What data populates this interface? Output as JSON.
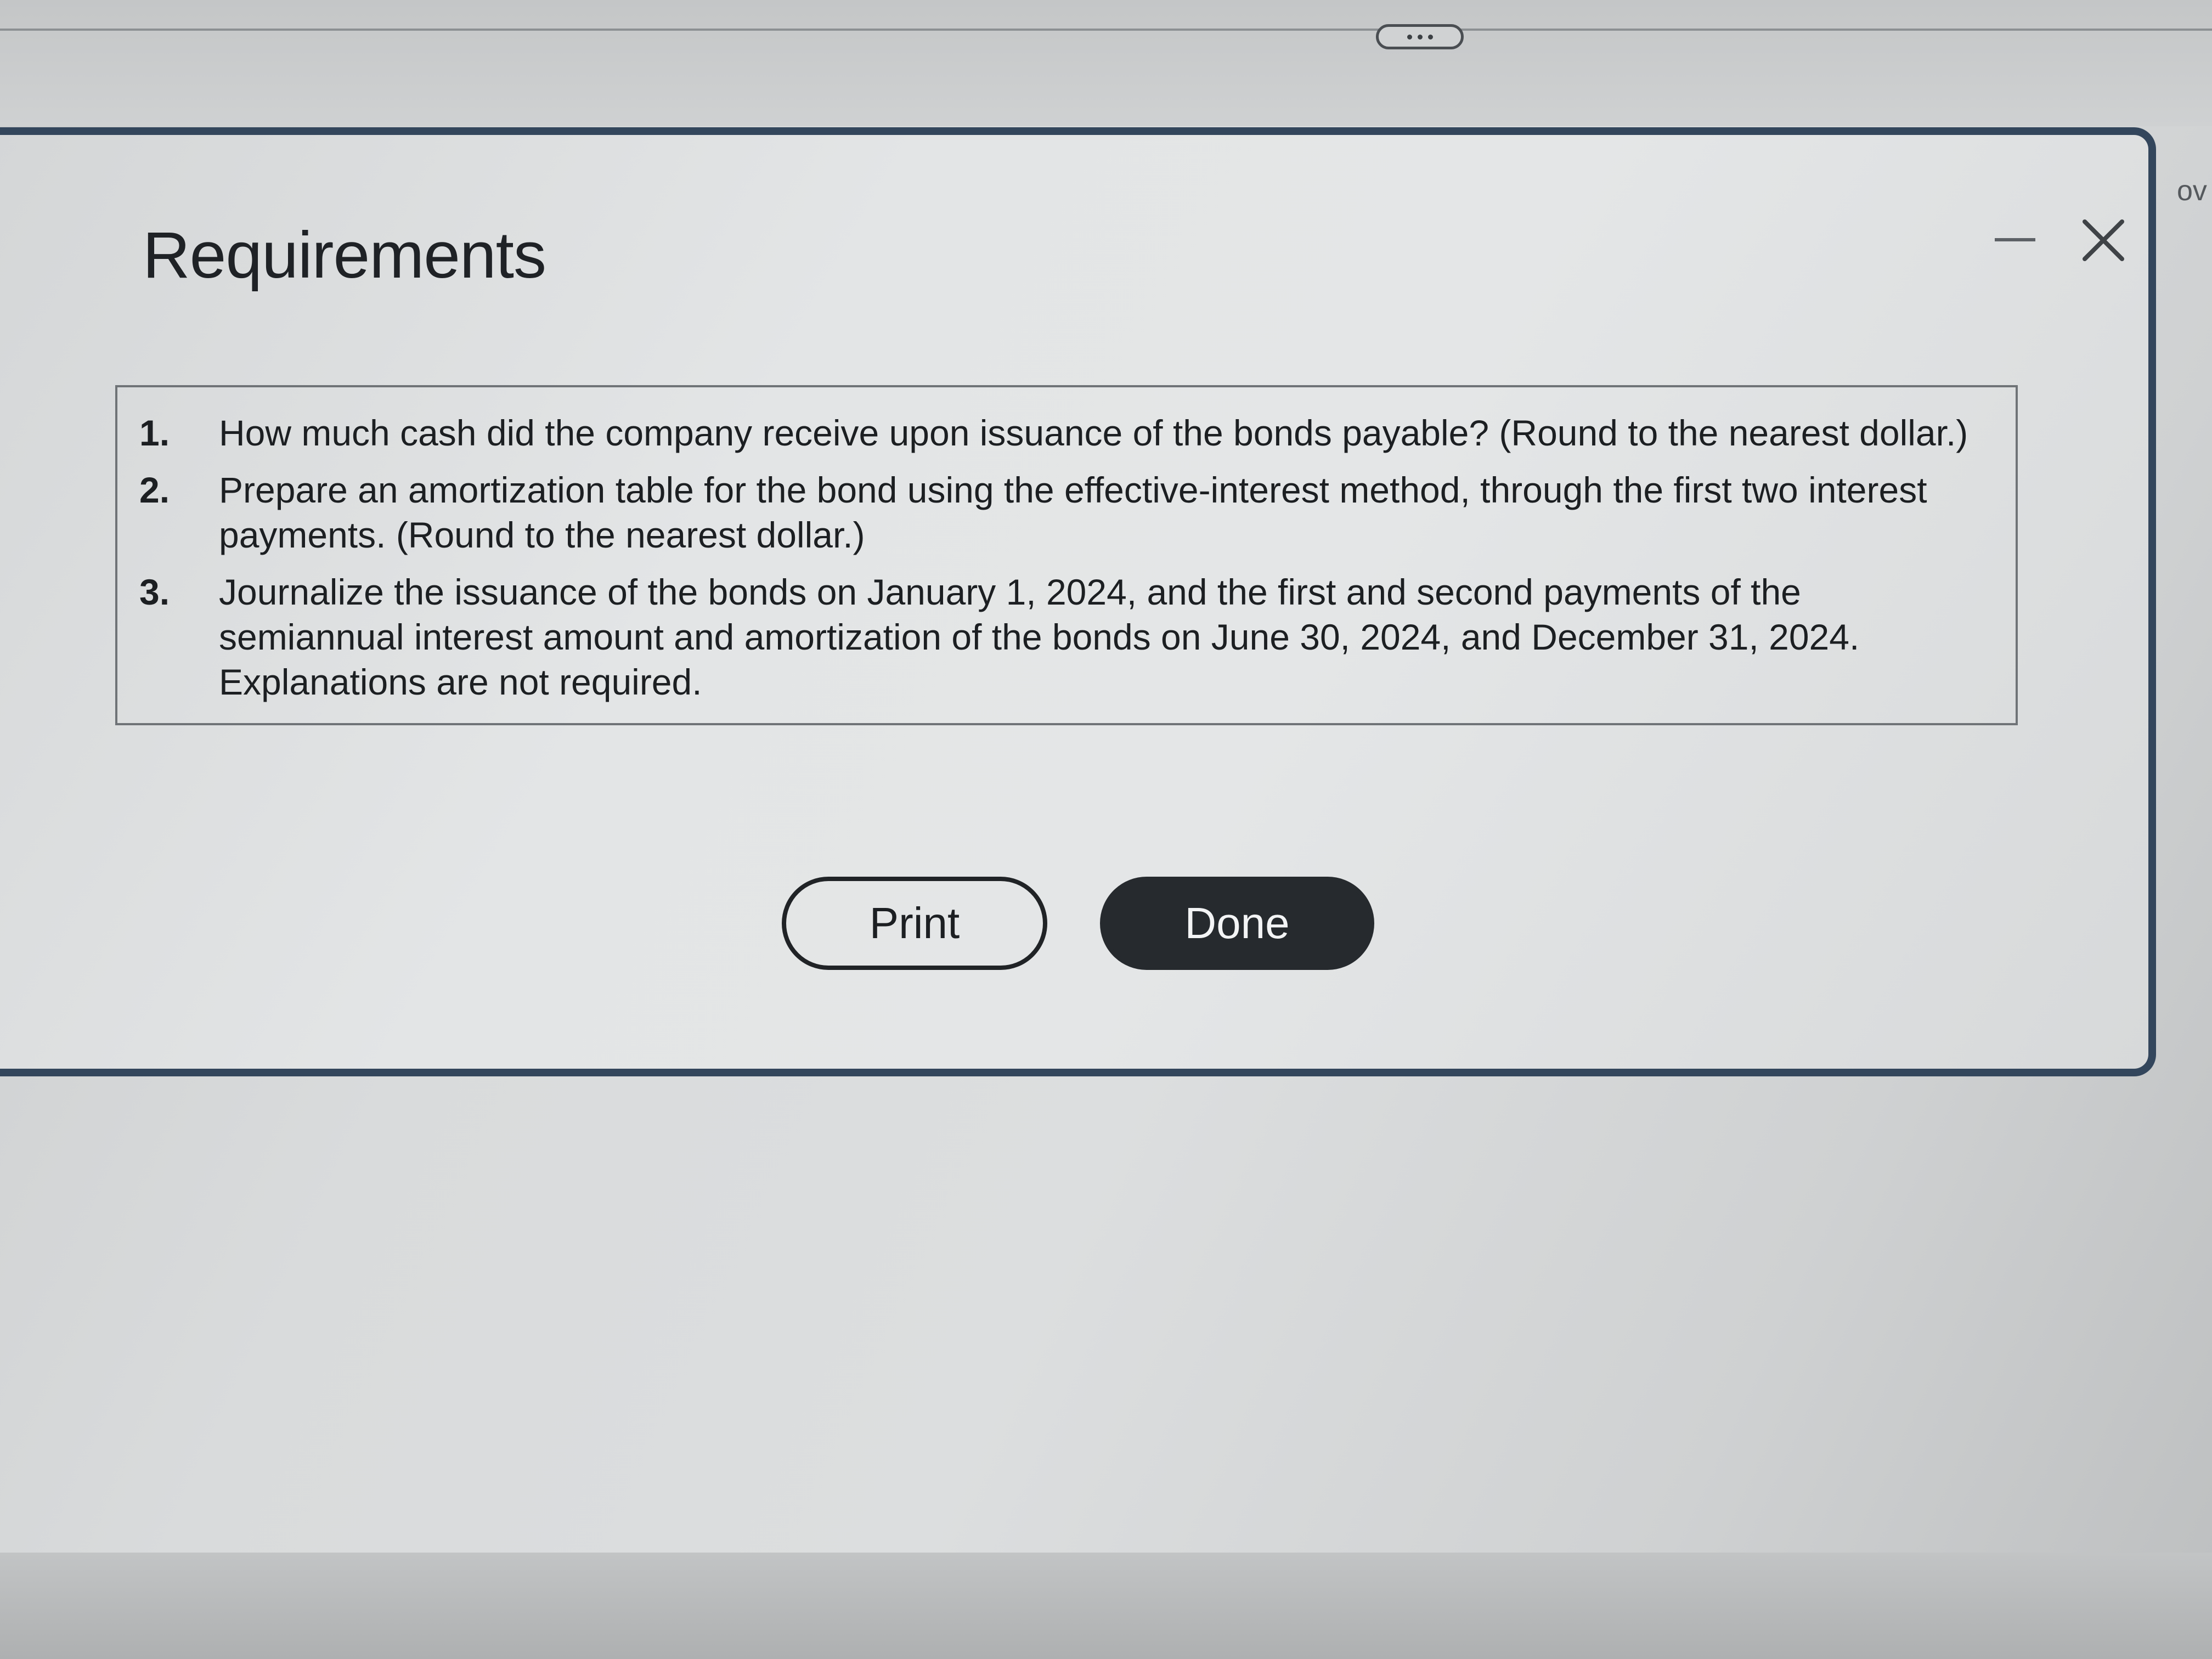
{
  "toolbar": {
    "handle_icon": "more-dots-icon"
  },
  "dialog": {
    "title": "Requirements",
    "minimize_icon": "minimize-icon",
    "close_icon": "close-x-icon",
    "requirements": [
      {
        "number": "1.",
        "text": "How much cash did the company receive upon issuance of the bonds payable? (Round to the nearest dollar.)"
      },
      {
        "number": "2.",
        "text": "Prepare an amortization table for the bond using the effective-interest method, through the first two interest payments. (Round to the nearest dollar.)"
      },
      {
        "number": "3.",
        "text": "Journalize the issuance of the bonds on January 1, 2024, and the first and second payments of the semiannual interest amount and amortization of the bonds on June 30, 2024, and December 31, 2024. Explanations are not required."
      }
    ],
    "print_label": "Print",
    "done_label": "Done"
  },
  "background": {
    "edge_text": "ov"
  },
  "colors": {
    "modal_border": "#33465c",
    "done_button": "#262a2e"
  }
}
